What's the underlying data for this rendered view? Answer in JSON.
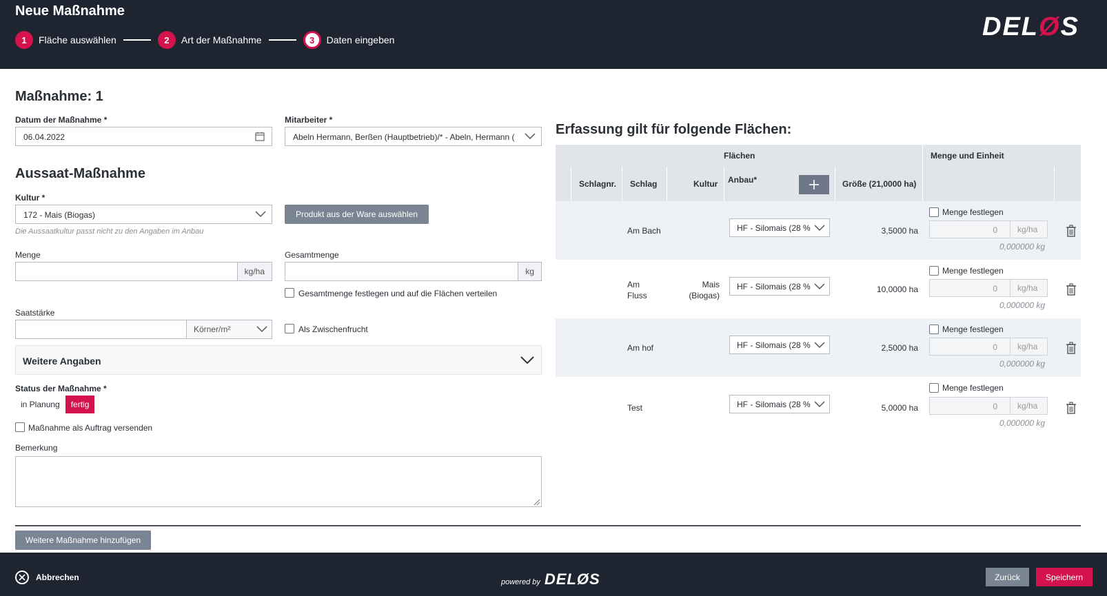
{
  "header": {
    "title": "Neue Maßnahme",
    "steps": [
      {
        "num": "1",
        "label": "Fläche auswählen"
      },
      {
        "num": "2",
        "label": "Art der Maßnahme"
      },
      {
        "num": "3",
        "label": "Daten eingeben"
      }
    ],
    "logo": "DELØS",
    "logo_a": "DEL",
    "logo_b": "Ø",
    "logo_c": "S"
  },
  "form": {
    "heading": "Maßnahme: 1",
    "date_label": "Datum der Maßnahme *",
    "date_value": "06.04.2022",
    "employee_label": "Mitarbeiter *",
    "employee_value": "Abeln Hermann, Berßen (Hauptbetrieb)/* - Abeln, Hermann (",
    "section_title": "Aussaat-Maßnahme",
    "kultur_label": "Kultur *",
    "kultur_value": "172 - Mais (Biogas)",
    "product_button": "Produkt aus der Ware auswählen",
    "kultur_hint": "Die Aussaatkultur passt nicht zu den Angaben im Anbau",
    "menge_label": "Menge",
    "menge_unit": "kg/ha",
    "gesamt_label": "Gesamtmenge",
    "gesamt_unit": "kg",
    "gesamt_checkbox": "Gesamtmenge festlegen und auf die Flächen verteilen",
    "saat_label": "Saatstärke",
    "saat_unit": "Körner/m²",
    "zwischen_checkbox": "Als Zwischenfrucht",
    "weitere_angaben": "Weitere Angaben",
    "status_label": "Status der Maßnahme *",
    "status_options": [
      "in Planung",
      "fertig"
    ],
    "auftrag_checkbox": "Maßnahme als Auftrag versenden",
    "bemerkung_label": "Bemerkung",
    "add_button": "Weitere Maßnahme hinzufügen"
  },
  "table": {
    "title": "Erfassung gilt für folgende Flächen:",
    "group_flaechen": "Flächen",
    "group_menge": "Menge und Einheit",
    "columns": {
      "schlagnr": "Schlagnr.",
      "schlag": "Schlag",
      "kultur": "Kultur",
      "anbau": "Anbau*",
      "groesse": "Größe (21,0000 ha)"
    },
    "rows": [
      {
        "schlag": "Am Bach",
        "kultur": "",
        "anbau": "HF - Silomais (28 %",
        "groesse": "3,5000 ha",
        "checkbox": "Menge festlegen",
        "qty": "0",
        "unit": "kg/ha",
        "total": "0,000000 kg"
      },
      {
        "schlag": "Am\nFluss",
        "kultur": "Mais\n(Biogas)",
        "anbau": "HF - Silomais (28 %",
        "groesse": "10,0000 ha",
        "checkbox": "Menge festlegen",
        "qty": "0",
        "unit": "kg/ha",
        "total": "0,000000 kg"
      },
      {
        "schlag": "Am hof",
        "kultur": "",
        "anbau": "HF - Silomais (28 %",
        "groesse": "2,5000 ha",
        "checkbox": "Menge festlegen",
        "qty": "0",
        "unit": "kg/ha",
        "total": "0,000000 kg"
      },
      {
        "schlag": "Test",
        "kultur": "",
        "anbau": "HF - Silomais (28 %",
        "groesse": "5,0000 ha",
        "checkbox": "Menge festlegen",
        "qty": "0",
        "unit": "kg/ha",
        "total": "0,000000 kg"
      }
    ]
  },
  "footer": {
    "cancel": "Abbrechen",
    "powered_by": "powered by",
    "logo": "DELØS",
    "back": "Zurück",
    "save": "Speichern"
  },
  "colors": {
    "accent": "#d3124e",
    "header_bg": "#1f2530",
    "button_grey": "#7a8593"
  }
}
